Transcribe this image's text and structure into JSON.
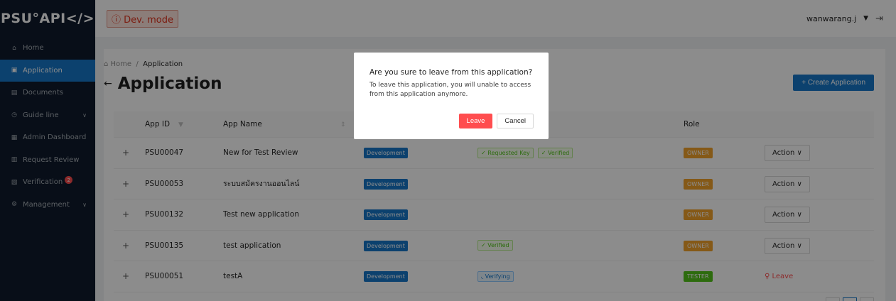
{
  "header": {
    "logo": "PSU°API</>",
    "dev_mode": "ⓘ Dev. mode",
    "username": "wanwarang.j",
    "caret": "▼",
    "logout_icon": "⇥"
  },
  "sidebar": {
    "items": [
      {
        "icon": "⌂",
        "label": "Home"
      },
      {
        "icon": "▣",
        "label": "Application"
      },
      {
        "icon": "▤",
        "label": "Documents"
      },
      {
        "icon": "◷",
        "label": "Guide line"
      },
      {
        "icon": "▦",
        "label": "Admin Dashboard"
      },
      {
        "icon": "▥",
        "label": "Request Review"
      },
      {
        "icon": "▧",
        "label": "Verification"
      },
      {
        "icon": "⚙",
        "label": "Management"
      }
    ],
    "verification_badge": "2"
  },
  "main": {
    "breadcrumb_home": "⌂ Home",
    "breadcrumb_sep": "/",
    "breadcrumb_current": "Application",
    "title": "Application",
    "back_icon": "←",
    "create_button": "+ Create Application",
    "columns": {
      "app_id": "App ID",
      "app_name": "App Name",
      "role": "Role"
    },
    "rows": [
      {
        "expand": "+",
        "id": "PSU00047",
        "name": "New for Test Review",
        "env": "Development",
        "status": [
          "✓ Requested Key",
          "✓ Verified"
        ],
        "role": "OWNER",
        "action": "Action ∨"
      },
      {
        "expand": "+",
        "id": "PSU00053",
        "name": "ระบบสมัครงานออนไลน์",
        "env": "Development",
        "status": [],
        "role": "OWNER",
        "action": "Action ∨"
      },
      {
        "expand": "+",
        "id": "PSU00132",
        "name": "Test new application",
        "env": "Development",
        "status": [],
        "role": "OWNER",
        "action": "Action ∨"
      },
      {
        "expand": "+",
        "id": "PSU00135",
        "name": "test application",
        "env": "Development",
        "status": [
          "✓ Verified"
        ],
        "role": "OWNER",
        "action": "Action ∨"
      },
      {
        "expand": "+",
        "id": "PSU00051",
        "name": "testA",
        "env": "Development",
        "status": [
          "◟ Verifying"
        ],
        "role": "TESTER",
        "action": "♀ Leave"
      }
    ]
  },
  "modal": {
    "title": "Are you sure to leave from this application?",
    "body_line1": "To leave this application, you will unable to access",
    "body_line2": "from this application anymore.",
    "leave_button": "Leave",
    "cancel_button": "Cancel"
  },
  "colors": {
    "sidebar_bg": "#0f1b2d",
    "accent": "#1677c9",
    "danger": "#ff4d4f",
    "owner": "#f2a32b",
    "tester": "#52c41a"
  }
}
